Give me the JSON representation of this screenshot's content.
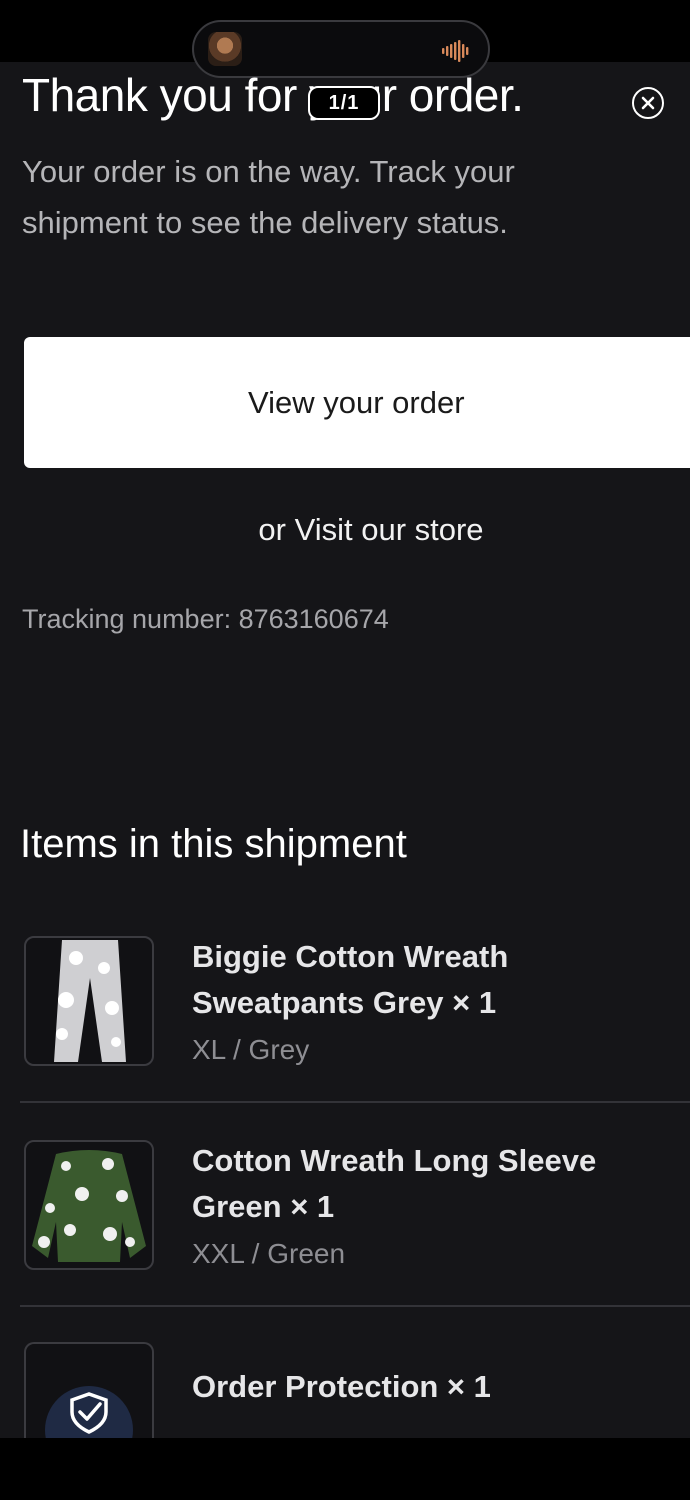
{
  "story": {
    "page_indicator": "1/1"
  },
  "header": {
    "title": "Thank you for your order.",
    "subtitle": "Your order is on the way. Track your shipment to see the delivery status."
  },
  "actions": {
    "view_order": "View your order",
    "visit_store": "or Visit our store"
  },
  "tracking": {
    "text": "Tracking number: 8763160674"
  },
  "shipment": {
    "title": "Items in this shipment",
    "items": [
      {
        "name": "Biggie Cotton Wreath Sweatpants Grey × 1",
        "variant": "XL / Grey",
        "icon": "sweatpants-image"
      },
      {
        "name": "Cotton Wreath Long Sleeve Green × 1",
        "variant": "XXL / Green",
        "icon": "long-sleeve-image"
      },
      {
        "name": "Order Protection × 1",
        "variant": "",
        "icon": "shield-check-icon"
      }
    ]
  },
  "colors": {
    "background": "#151518",
    "button": "#ffffff",
    "accent_navy": "#1f2a44"
  }
}
